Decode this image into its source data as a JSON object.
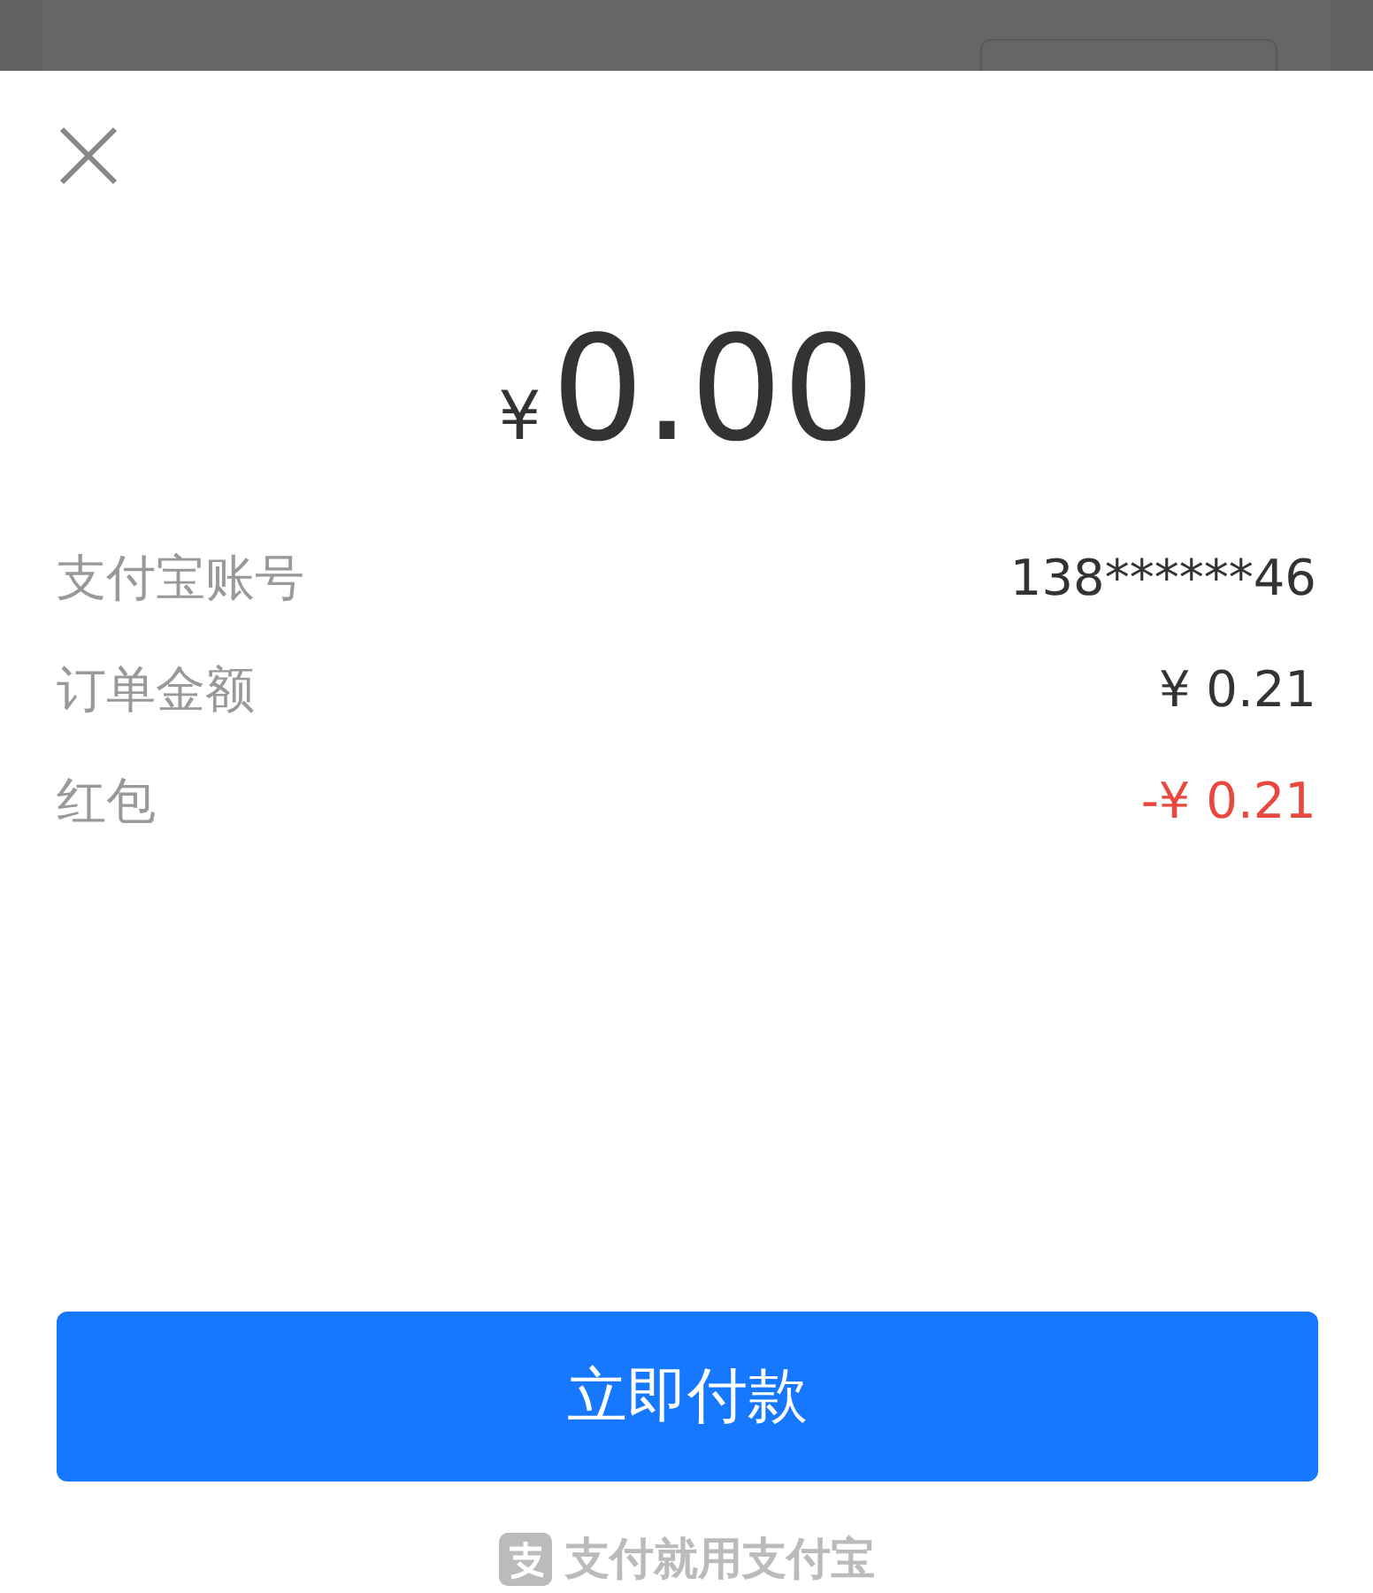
{
  "amount": {
    "currency": "¥",
    "value": "0.00"
  },
  "details": [
    {
      "label": "支付宝账号",
      "value": "138******46",
      "kind": "normal"
    },
    {
      "label": "订单金额",
      "value": "¥ 0.21",
      "kind": "normal"
    },
    {
      "label": "红包",
      "value": "-¥ 0.21",
      "kind": "discount"
    }
  ],
  "pay_button": "立即付款",
  "footer": "支付就用支付宝"
}
